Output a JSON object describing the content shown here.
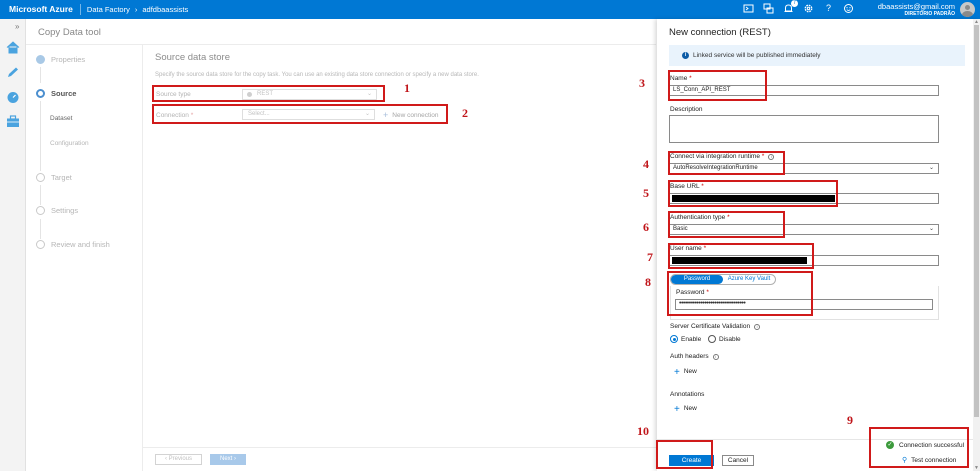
{
  "topbar": {
    "brand": "Microsoft Azure",
    "breadcrumb": [
      "Data Factory",
      "adfdbaassists"
    ],
    "notification_count": "7",
    "user_email": "dbaassists@gmail.com",
    "user_directory": "DIRETÓRIO PADRÃO",
    "icons": [
      "cloud-shell-icon",
      "directory-icon",
      "notifications-icon",
      "settings-icon",
      "help-icon",
      "feedback-icon"
    ]
  },
  "tool": {
    "title": "Copy Data tool",
    "steps": [
      {
        "label": "Properties",
        "state": "done"
      },
      {
        "label": "Source",
        "state": "active"
      },
      {
        "label": "Dataset",
        "state": "sub-active"
      },
      {
        "label": "Configuration",
        "state": "sub"
      },
      {
        "label": "Target",
        "state": "pending"
      },
      {
        "label": "Settings",
        "state": "pending"
      },
      {
        "label": "Review and finish",
        "state": "pending"
      }
    ],
    "main_title": "Source data store",
    "main_desc": "Specify the source data store for the copy task. You can use an existing data store connection or specify a new data store.",
    "source_type_label": "Source type",
    "source_type_value": "REST",
    "connection_label": "Connection",
    "connection_placeholder": "Select...",
    "new_connection": "New connection",
    "prev_label": "Previous",
    "next_label": "Next"
  },
  "panel": {
    "title": "New connection (REST)",
    "info": "Linked service will be published immediately",
    "name_label": "Name",
    "name_value": "LS_Conn_API_REST",
    "description_label": "Description",
    "runtime_label": "Connect via integration runtime",
    "runtime_value": "AutoResolveIntegrationRuntime",
    "base_url_label": "Base URL",
    "auth_label": "Authentication type",
    "auth_value": "Basic",
    "username_label": "User name",
    "toggle": [
      "Password",
      "Azure Key Vault"
    ],
    "password_label": "Password",
    "password_value": "••••••••••••••••••••••••••••••••••",
    "cert_label": "Server Certificate Validation",
    "radio_enable": "Enable",
    "radio_disable": "Disable",
    "auth_headers_label": "Auth headers",
    "annotations_label": "Annotations",
    "new_label": "New",
    "create_label": "Create",
    "cancel_label": "Cancel",
    "status_text": "Connection successful",
    "test_label": "Test connection"
  },
  "annotations": {
    "numbers": [
      "1",
      "2",
      "3",
      "4",
      "5",
      "6",
      "7",
      "8",
      "9",
      "10"
    ],
    "color": "#d01a1a"
  },
  "colors": {
    "azure_blue": "#0078d4",
    "success_green": "#3c9a3c",
    "info_bg": "#e9f3fc"
  }
}
